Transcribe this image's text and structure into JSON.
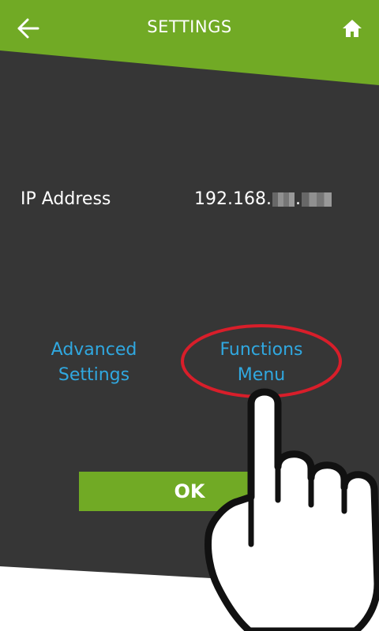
{
  "header": {
    "title": "SETTINGS",
    "back_icon": "arrow-left-icon",
    "home_icon": "home-icon"
  },
  "network": {
    "ip_label": "IP Address",
    "ip_value_visible": "192.168.",
    "ip_value_dot": "."
  },
  "links": {
    "advanced_line1": "Advanced",
    "advanced_line2": "Settings",
    "functions_line1": "Functions",
    "functions_line2": "Menu"
  },
  "actions": {
    "ok_label": "OK"
  },
  "colors": {
    "green": "#71aa25",
    "dark": "#363636",
    "link": "#30a8e0",
    "highlight": "#d81e2a"
  }
}
